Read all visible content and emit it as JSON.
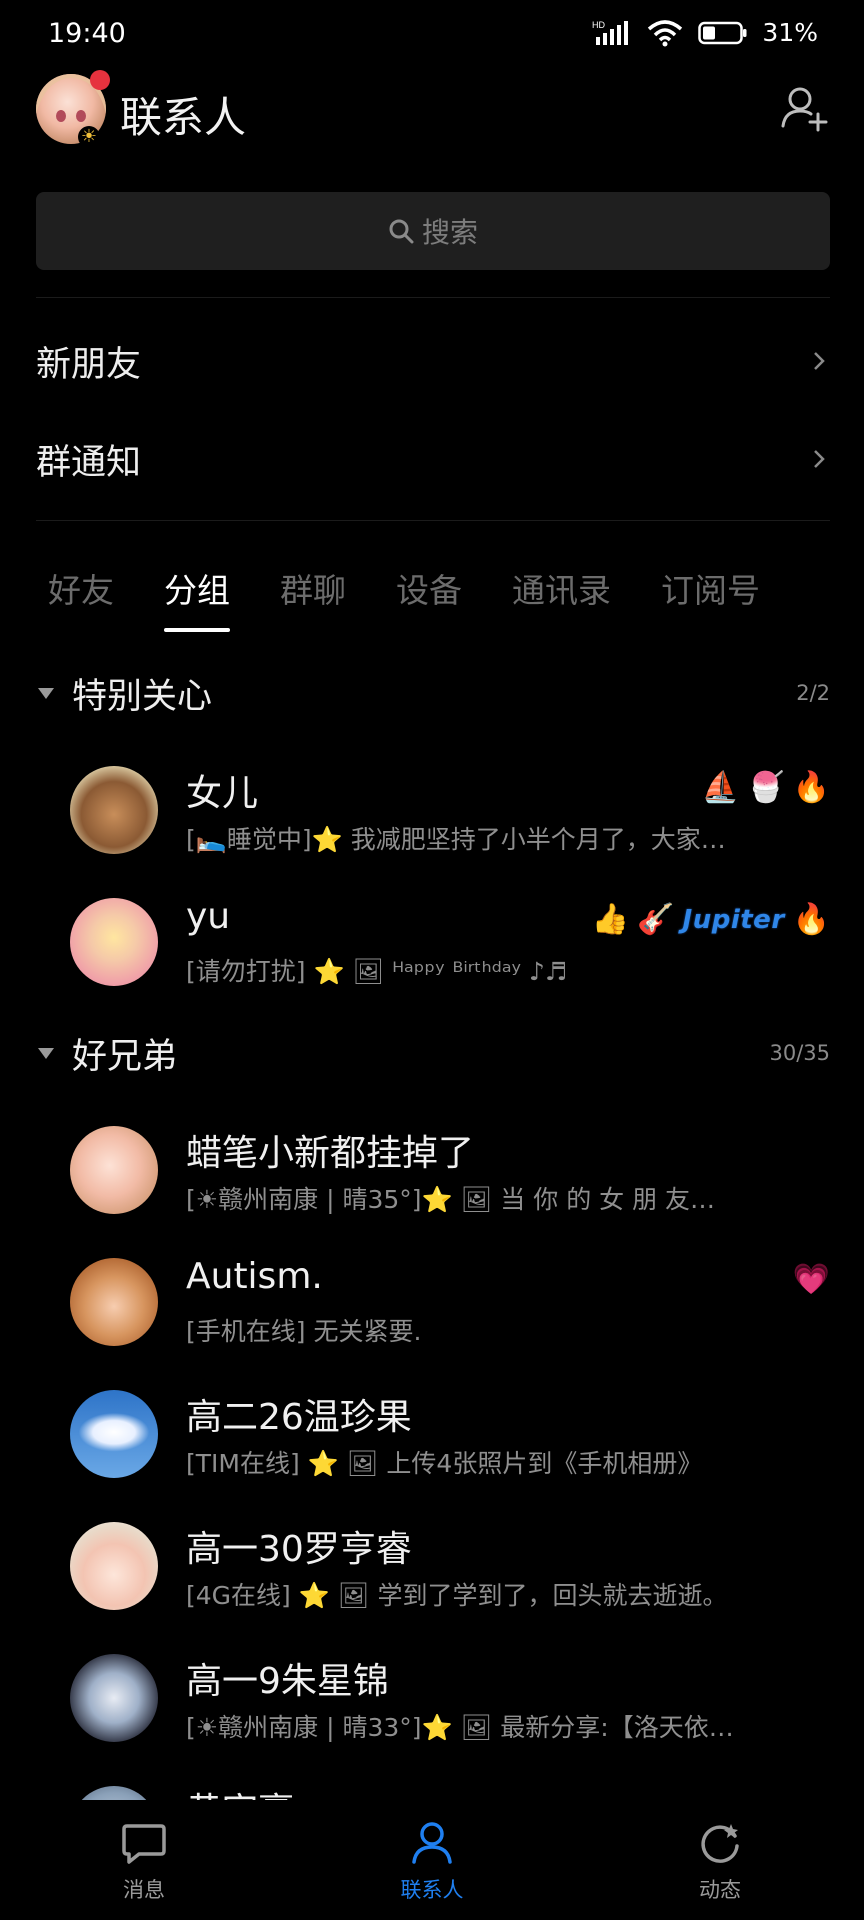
{
  "status_bar": {
    "time": "19:40",
    "battery": "31%"
  },
  "header": {
    "title": "联系人"
  },
  "search": {
    "placeholder": "搜索"
  },
  "nav_rows": [
    {
      "label": "新朋友"
    },
    {
      "label": "群通知"
    }
  ],
  "tabs": [
    "好友",
    "分组",
    "群聊",
    "设备",
    "通讯录",
    "订阅号"
  ],
  "active_tab": "分组",
  "groups": [
    {
      "name": "特别关心",
      "count": "2/2"
    },
    {
      "name": "好兄弟",
      "count": "30/35"
    }
  ],
  "contacts": [
    {
      "name": "女儿",
      "status": "[🛌睡觉中]⭐ 我减肥坚持了小半个月了，大家…",
      "badges": [
        "⛵",
        "🍧",
        "🔥"
      ]
    },
    {
      "name": "yu",
      "status": "[请勿打扰] ⭐ 🖼  ᴴᵃᵖᵖʸ ᴮⁱʳᵗʰᵈᵃʸ ♪♬",
      "badges": [
        "👍",
        "🎸",
        "🔥"
      ],
      "badge_text": "Jupiter"
    },
    {
      "name": "蜡笔小新都挂掉了",
      "status": "[☀赣州南康 | 晴35°]⭐ 🖼 当 你 的 女 朋 友…",
      "badges": []
    },
    {
      "name": "Autism.",
      "status": "[手机在线] 无关紧要.",
      "badges": [
        "💗"
      ]
    },
    {
      "name": "高二26温珍果",
      "status": "[TIM在线] ⭐ 🖼 上传4张照片到《手机相册》",
      "badges": []
    },
    {
      "name": "高一30罗亨睿",
      "status": "[4G在线] ⭐ 🖼 学到了学到了，回头就去逝逝。",
      "badges": []
    },
    {
      "name": "高一9朱星锦",
      "status": "[☀赣州南康 | 晴33°]⭐ 🖼 最新分享:【洛天依…",
      "badges": []
    },
    {
      "name": "黄宇豪",
      "status": "",
      "badges": []
    }
  ],
  "bottom_nav": [
    {
      "label": "消息",
      "icon": "chat-bubble-icon"
    },
    {
      "label": "联系人",
      "icon": "person-icon"
    },
    {
      "label": "动态",
      "icon": "refresh-star-icon"
    }
  ],
  "colors": {
    "accent": "#1f7ff0",
    "background": "#000000"
  }
}
